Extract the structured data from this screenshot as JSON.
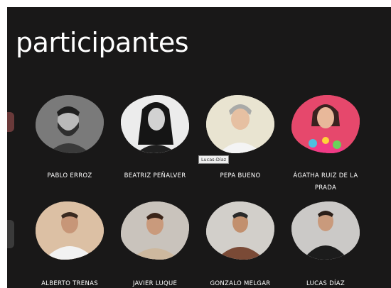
{
  "page": {
    "title": "participantes",
    "colors": {
      "background": "#191818",
      "text": "#ffffff"
    }
  },
  "participants": [
    {
      "name": "PABLO ERROZ",
      "photo": "man-beard-bw",
      "tone": "#5b5b5b"
    },
    {
      "name": "BEATRIZ PEÑALVER",
      "photo": "woman-dark-hair-bw",
      "tone": "#efefef"
    },
    {
      "name": "PEPA BUENO",
      "photo": "woman-gray-hair",
      "tone": "#e9e4d1"
    },
    {
      "name": "ÁGATHA RUIZ DE LA PRADA",
      "photo": "woman-colorful-dress",
      "tone": "#ea4e6f"
    },
    {
      "name": "ALBERTO TRENAS",
      "photo": "man-white-tshirt",
      "tone": "#e8c8a8"
    },
    {
      "name": "JAVIER LUQUE",
      "photo": "man-beige-shirt",
      "tone": "#c9c3bc"
    },
    {
      "name": "GONZALO MELGAR",
      "photo": "man-brown-jacket",
      "tone": "#d0cdc8"
    },
    {
      "name": "LUCAS DÍAZ",
      "photo": "man-black-jacket",
      "tone": "#c8c6c4"
    }
  ],
  "tooltip": {
    "text": "Lucas-Díaz"
  }
}
